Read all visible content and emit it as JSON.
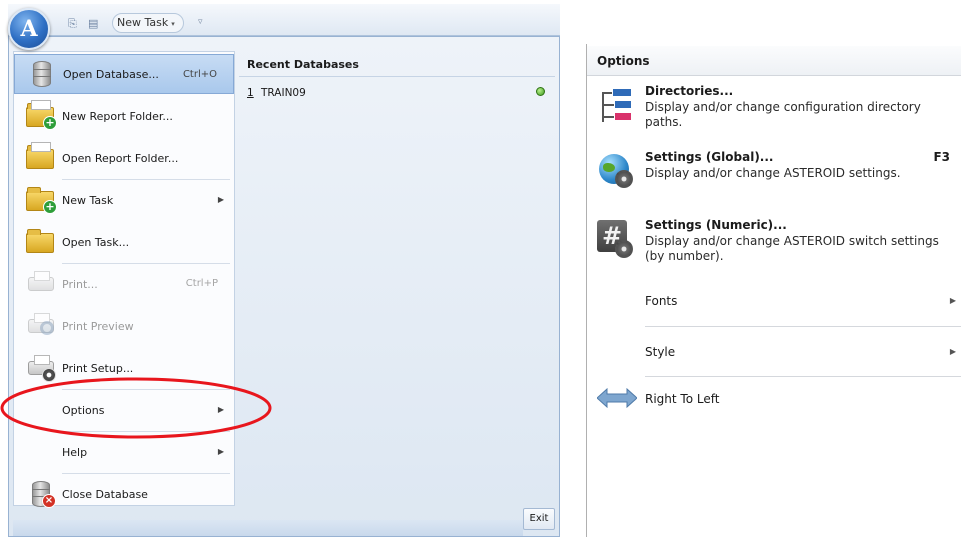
{
  "quick_access": {
    "app_letter": "A",
    "new_task_label": "New Task",
    "new_task_arrow": "▾",
    "customize_arrow": "▿"
  },
  "app_menu": {
    "items": [
      {
        "label": "Open Database...",
        "shortcut": "Ctrl+O",
        "icon": "database-icon",
        "highlighted": true,
        "enabled": true
      },
      {
        "label": "New Report Folder...",
        "icon": "new-folder-icon",
        "enabled": true
      },
      {
        "label": "Open Report Folder...",
        "icon": "open-folder-icon",
        "enabled": true
      },
      {
        "label": "New Task",
        "icon": "new-task-icon",
        "submenu": true,
        "enabled": true
      },
      {
        "label": "Open Task...",
        "icon": "open-task-icon",
        "enabled": true
      },
      {
        "label": "Print...",
        "shortcut": "Ctrl+P",
        "icon": "printer-icon",
        "enabled": false
      },
      {
        "label": "Print Preview",
        "icon": "print-preview-icon",
        "enabled": false
      },
      {
        "label": "Print Setup...",
        "icon": "print-setup-icon",
        "enabled": true
      },
      {
        "label": "Options",
        "submenu": true,
        "enabled": true
      },
      {
        "label": "Help",
        "submenu": true,
        "enabled": true
      },
      {
        "label": "Close Database",
        "icon": "close-database-icon",
        "enabled": true
      }
    ],
    "submenu_arrow": "▶",
    "recent": {
      "header": "Recent Databases",
      "items": [
        {
          "number": "1",
          "name": "TRAIN09",
          "pinned": true
        }
      ]
    },
    "exit_label": "Exit"
  },
  "options_menu": {
    "header": "Options",
    "items": [
      {
        "title": "Directories...",
        "description": "Display and/or change configuration directory paths.",
        "icon": "directory-tree-icon"
      },
      {
        "title": "Settings (Global)...",
        "shortcut": "F3",
        "description": "Display and/or change ASTEROID settings.",
        "icon": "globe-gear-icon"
      },
      {
        "title": "Settings (Numeric)...",
        "description": "Display and/or change ASTEROID switch settings (by number).",
        "icon": "hash-gear-icon"
      },
      {
        "label": "Fonts",
        "submenu": true
      },
      {
        "label": "Style",
        "submenu": true
      },
      {
        "label": "Right To Left",
        "icon": "right-to-left-icon"
      }
    ]
  },
  "colors": {
    "highlight": "#a9c8ec",
    "annotation": "#e8161d",
    "menu_border": "#98b2d2"
  }
}
